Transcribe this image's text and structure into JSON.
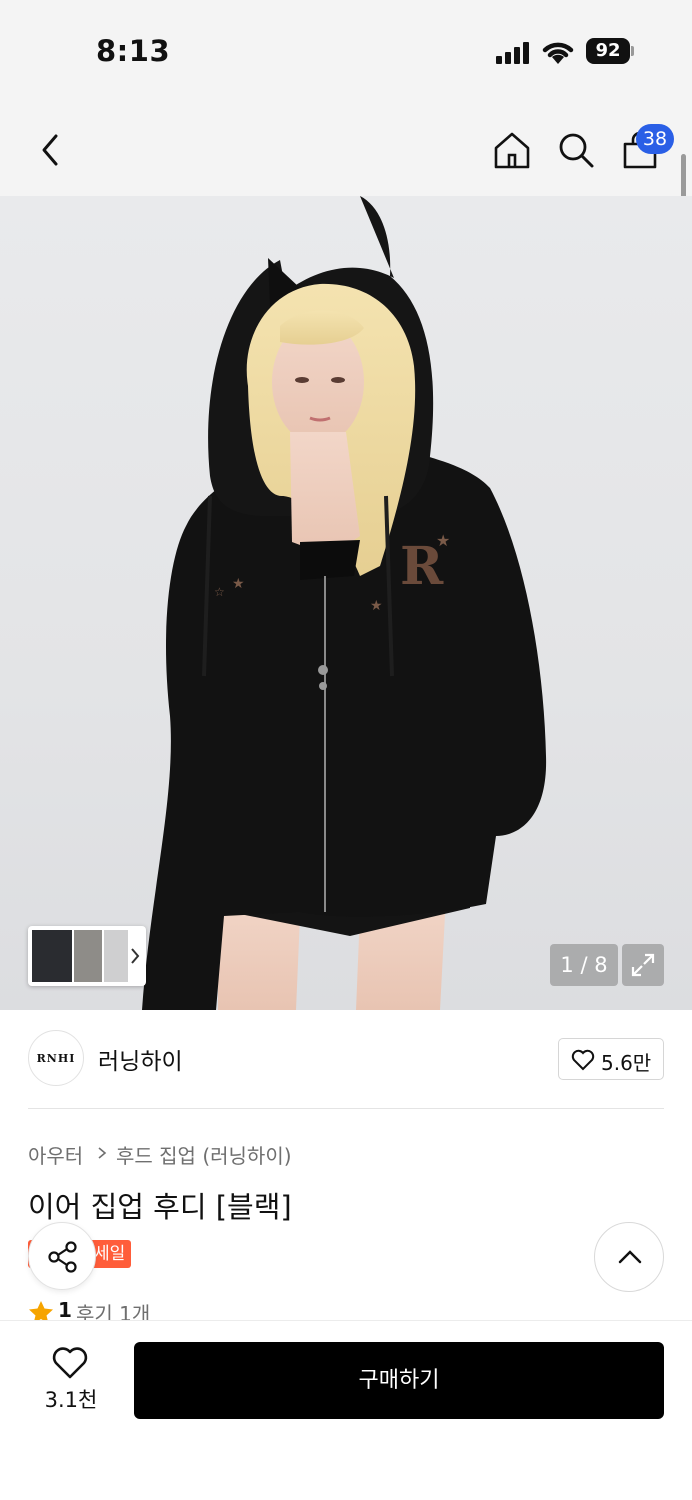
{
  "status_bar": {
    "time": "8:13",
    "battery": "92"
  },
  "nav": {
    "cart_count": "38",
    "icons": [
      "back-arrow-icon",
      "home-icon",
      "search-icon",
      "shopping-bag-icon"
    ]
  },
  "gallery": {
    "counter": "1 / 8",
    "current_image": 1,
    "total_images": 8
  },
  "brand": {
    "logo_text": "RNHI",
    "name": "러닝하이",
    "like_count": "5.6만"
  },
  "product": {
    "breadcrumb": [
      "아우터",
      "후드 집업 (러닝하이)"
    ],
    "title": "이어 집업 후디 [블랙]",
    "badge": "세일",
    "rating": "1",
    "review_text": "후기 1개"
  },
  "bottom_bar": {
    "wish_count": "3.1천",
    "buy_label": "구매하기"
  },
  "colors": {
    "cart_badge": "#2a5fe6",
    "sale_badge": "#ff5d3a",
    "star": "#f6a400",
    "buy_button": "#000000"
  }
}
